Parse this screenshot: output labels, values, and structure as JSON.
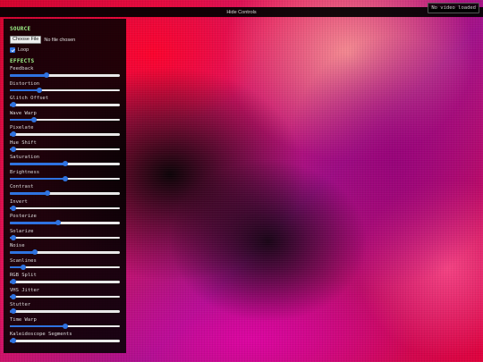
{
  "header": {
    "hide_label": "Hide Controls"
  },
  "status": {
    "text": "No video loaded"
  },
  "source": {
    "title": "SOURCE",
    "choose_file_label": "Choose File",
    "file_status": "No file chosen",
    "loop_label": "Loop",
    "loop_checked": true
  },
  "effects": {
    "title": "EFFECTS",
    "sliders": [
      {
        "label": "Feedback",
        "value": 0.33
      },
      {
        "label": "Distortion",
        "value": 0.27
      },
      {
        "label": "Glitch Offset",
        "value": 0.03
      },
      {
        "label": "Wave Warp",
        "value": 0.22
      },
      {
        "label": "Pixelate",
        "value": 0.03
      },
      {
        "label": "Hue Shift",
        "value": 0.03
      },
      {
        "label": "Saturation",
        "value": 0.5
      },
      {
        "label": "Brightness",
        "value": 0.5
      },
      {
        "label": "Contrast",
        "value": 0.34
      },
      {
        "label": "Invert",
        "value": 0.03
      },
      {
        "label": "Posterize",
        "value": 0.44
      },
      {
        "label": "Solarize",
        "value": 0.03
      },
      {
        "label": "Noise",
        "value": 0.23
      },
      {
        "label": "Scanlines",
        "value": 0.12
      },
      {
        "label": "RGB Split",
        "value": 0.03
      },
      {
        "label": "VHS Jitter",
        "value": 0.03
      },
      {
        "label": "Stutter",
        "value": 0.03
      },
      {
        "label": "Time Warp",
        "value": 0.5
      },
      {
        "label": "Kaleidoscope Segments",
        "value": 0.03
      }
    ]
  },
  "colors": {
    "accent": "#2f73e0",
    "section_title": "#9ef58a"
  }
}
